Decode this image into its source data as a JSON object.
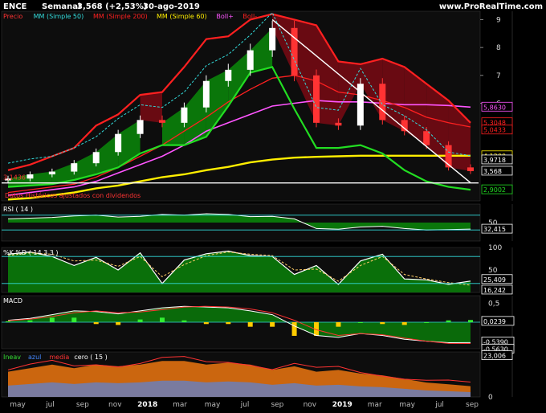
{
  "header": {
    "symbol": "ENCE",
    "period": "Semanal",
    "quote": "3,568 (+2,53%)",
    "date": "30-ago-2019",
    "site": "www.ProRealTime.com"
  },
  "colors": {
    "background": "#000000",
    "panel_bg": "#0d0d0d",
    "price_text": "#ff3333",
    "mm50": "#ff2020",
    "mm200": "#ffee00",
    "mm60": "#ff55ff",
    "boll_minus": "#22dd22",
    "boll_plus": "#ff2020",
    "candle_up": "#ffffff",
    "candle_down": "#ff3333",
    "fill_green": "#0a8a0a",
    "fill_red": "#7a0a14",
    "cyan": "#33dddd",
    "white_line": "#ffffff",
    "macd_hist_pos": "#33ee33",
    "macd_hist_neg": "#ffcc00",
    "macd_dark": "#8a0a14",
    "tickers_orange": "#e07010",
    "tickers_blue": "#4488ff"
  },
  "chart_data": [
    {
      "type": "line",
      "title": "ENCE Semanal",
      "legend": [
        "Precio",
        "MM (Simple 50)",
        "MM (Simple 200)",
        "MM (Simple 60)",
        "Boll+",
        "Boll-"
      ],
      "x": [
        "may",
        "jul",
        "sep",
        "nov",
        "2018",
        "mar",
        "may",
        "jul",
        "sep",
        "nov",
        "2019",
        "mar",
        "may",
        "jul",
        "sep"
      ],
      "ylim": [
        2.5,
        9.3
      ],
      "yticks": [
        6,
        7,
        8,
        9
      ],
      "price_labels": [
        "5,8630",
        "5,3048",
        "5,0433",
        "4,1200",
        "3,9718",
        "3,568",
        "2,9002"
      ],
      "left_label": "3,1436",
      "note": "Datos Históricos ajustados con dividendos",
      "series": [
        {
          "name": "Precio",
          "values": [
            3.3,
            3.45,
            3.55,
            3.85,
            4.25,
            4.9,
            5.4,
            5.3,
            5.85,
            6.8,
            7.2,
            7.9,
            8.7,
            7.0,
            5.3,
            5.2,
            6.7,
            5.4,
            5.0,
            4.5,
            3.7,
            3.568
          ]
        },
        {
          "name": "MM (Simple 50)",
          "values": [
            2.8,
            2.9,
            3.0,
            3.1,
            3.35,
            3.7,
            4.1,
            4.5,
            5.0,
            5.5,
            6.05,
            6.5,
            6.9,
            7.0,
            6.8,
            6.4,
            6.3,
            6.1,
            5.85,
            5.5,
            5.3,
            5.15
          ]
        },
        {
          "name": "MM (Simple 200)",
          "values": [
            2.55,
            2.6,
            2.7,
            2.8,
            2.95,
            3.05,
            3.2,
            3.35,
            3.45,
            3.6,
            3.72,
            3.88,
            3.98,
            4.05,
            4.08,
            4.1,
            4.12,
            4.12,
            4.12,
            4.12,
            4.12,
            4.12
          ]
        },
        {
          "name": "MM (Simple 60)",
          "values": [
            2.7,
            2.8,
            2.9,
            3.0,
            3.2,
            3.5,
            3.8,
            4.1,
            4.5,
            5.0,
            5.3,
            5.6,
            5.9,
            6.0,
            6.1,
            6.05,
            6.05,
            6.0,
            5.95,
            5.95,
            5.92,
            5.863
          ]
        },
        {
          "name": "Boll+",
          "values": [
            3.6,
            3.8,
            4.1,
            4.4,
            5.2,
            5.6,
            6.3,
            6.4,
            7.3,
            8.3,
            8.4,
            9.0,
            9.2,
            9.0,
            8.8,
            7.5,
            7.4,
            7.6,
            7.3,
            6.7,
            6.1,
            5.3
          ]
        },
        {
          "name": "Boll-",
          "values": [
            3.0,
            3.05,
            3.1,
            3.25,
            3.45,
            3.7,
            4.2,
            4.5,
            4.5,
            4.8,
            5.9,
            7.1,
            7.3,
            5.8,
            4.4,
            4.4,
            4.5,
            4.2,
            3.6,
            3.2,
            3.0,
            2.9
          ]
        }
      ]
    },
    {
      "type": "area",
      "title": "RSI ( 14 )",
      "ylim": [
        0,
        100
      ],
      "yticks": [
        50
      ],
      "levels": [
        30,
        70
      ],
      "current_label": "32,415",
      "values": [
        60,
        62,
        64,
        68,
        70,
        65,
        67,
        72,
        70,
        74,
        72,
        66,
        67,
        60,
        34,
        32,
        38,
        40,
        34,
        30,
        31,
        32.4
      ]
    },
    {
      "type": "area",
      "title": "%K %D ( 14 3 3 )",
      "ylim": [
        0,
        100
      ],
      "yticks": [
        50,
        100
      ],
      "levels": [
        20,
        80
      ],
      "labels": [
        "25,409",
        "16,242"
      ],
      "series": [
        {
          "name": "%K",
          "values": [
            85,
            90,
            80,
            60,
            78,
            50,
            88,
            20,
            72,
            86,
            92,
            82,
            80,
            40,
            60,
            18,
            70,
            85,
            30,
            28,
            18,
            25.4
          ]
        },
        {
          "name": "%D",
          "values": [
            82,
            88,
            85,
            70,
            72,
            58,
            80,
            35,
            62,
            82,
            90,
            85,
            82,
            50,
            52,
            25,
            60,
            80,
            40,
            30,
            22,
            16.2
          ]
        }
      ]
    },
    {
      "type": "bar",
      "title": "MACD",
      "ylim": [
        -0.7,
        0.7
      ],
      "yticks": [
        0.5,
        0
      ],
      "labels": [
        "0,0239",
        "-0,5390",
        "-0,5630"
      ],
      "series": [
        {
          "name": "MACD",
          "values": [
            0.05,
            0.1,
            0.2,
            0.3,
            0.28,
            0.22,
            0.3,
            0.38,
            0.42,
            0.4,
            0.38,
            0.3,
            0.2,
            -0.1,
            -0.35,
            -0.4,
            -0.3,
            -0.35,
            -0.45,
            -0.5,
            -0.54,
            -0.539
          ]
        },
        {
          "name": "Señal",
          "values": [
            0.04,
            0.08,
            0.15,
            0.25,
            0.3,
            0.25,
            0.27,
            0.33,
            0.4,
            0.42,
            0.4,
            0.35,
            0.25,
            0.05,
            -0.2,
            -0.35,
            -0.3,
            -0.33,
            -0.42,
            -0.5,
            -0.56,
            -0.563
          ]
        },
        {
          "name": "Histograma",
          "values": [
            0.01,
            0.02,
            0.05,
            0.05,
            -0.02,
            -0.03,
            0.03,
            0.05,
            0.02,
            -0.02,
            -0.02,
            -0.05,
            -0.05,
            -0.15,
            -0.15,
            -0.05,
            0.0,
            -0.02,
            -0.03,
            0.0,
            0.02,
            0.024
          ]
        }
      ]
    },
    {
      "type": "area",
      "title": "tickers",
      "legend": [
        "Ineav",
        "azul",
        "media",
        "cero ( 15 )"
      ],
      "ylim": [
        0,
        25
      ],
      "yticks": [
        0
      ],
      "labels": [
        "23,006",
        "0"
      ],
      "values": [
        14,
        16,
        18,
        16,
        18,
        17,
        18,
        20,
        20,
        18,
        19,
        18,
        15,
        17,
        14,
        15,
        13,
        12,
        10,
        8,
        7,
        6
      ]
    }
  ]
}
